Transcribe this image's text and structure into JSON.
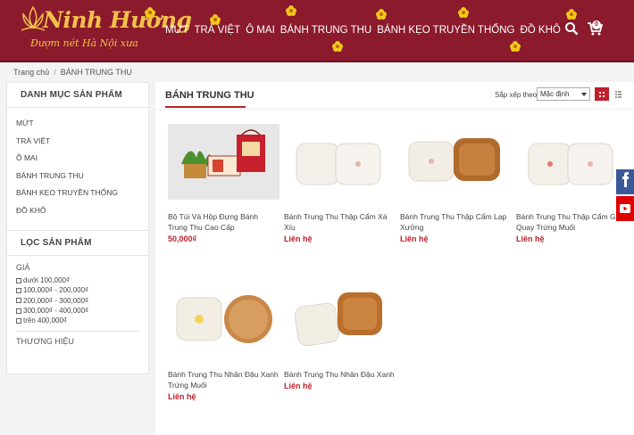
{
  "brand": {
    "name": "Ninh Hương",
    "tagline": "Đượm nét Hà Nội xưa",
    "primary_color": "#8b1a2c",
    "accent_color": "#c0202b"
  },
  "nav": {
    "items": [
      "MỨT",
      "TRÀ VIỆT",
      "Ô MAI",
      "BÁNH TRUNG THU",
      "BÁNH KẸO TRUYỀN THỐNG",
      "ĐỒ KHÔ"
    ],
    "cart_count": "0",
    "search_icon": "search-icon",
    "cart_icon": "cart-icon"
  },
  "breadcrumb": {
    "home": "Trang chủ",
    "separator": "/",
    "current": "BÁNH TRUNG THU"
  },
  "sidebar": {
    "categories_title": "DANH MỤC SẢN PHẨM",
    "categories": [
      "MỨT",
      "TRÀ VIỆT",
      "Ô MAI",
      "BÁNH TRUNG THU",
      "BÁNH KẸO TRUYỀN THỐNG",
      "ĐỒ KHÔ"
    ],
    "filter_title": "LỌC SẢN PHẨM",
    "price_label": "GIÁ",
    "price_ranges": [
      "dưới 100,000₫",
      "100,000₫ - 200,000₫",
      "200,000₫ - 300,000₫",
      "300,000₫ - 400,000₫",
      "trên 400,000₫"
    ],
    "brand_label": "THƯƠNG HIỆU"
  },
  "main": {
    "title": "BÁNH TRUNG THU",
    "sort_label": "Sắp xếp theo:",
    "sort_value": "Mặc định",
    "products": [
      {
        "name": "Bộ Túi Và Hộp Đựng Bánh Trung Thu Cao Cấp",
        "price": "50,000₫"
      },
      {
        "name": "Bánh Trung Thu Thập Cẩm Xá Xíu",
        "price": "Liên hệ"
      },
      {
        "name": "Bánh Trung Thu Thập Cẩm Lạp Xưởng",
        "price": "Liên hệ"
      },
      {
        "name": "Bánh Trung Thu Thập Cẩm Gà Quay Trứng Muối",
        "price": "Liên hệ"
      },
      {
        "name": "Bánh Trung Thu Nhân Đậu Xanh Trứng Muối",
        "price": "Liên hệ"
      },
      {
        "name": "Bánh Trung Thu Nhân Đậu Xanh",
        "price": "Liên hệ"
      }
    ]
  },
  "social": {
    "facebook_icon": "facebook-icon",
    "youtube_icon": "youtube-icon"
  }
}
